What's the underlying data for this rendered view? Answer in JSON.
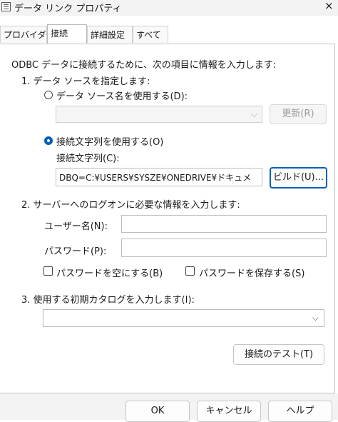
{
  "window": {
    "title": "データ リンク プロパティ",
    "close_glyph": "×"
  },
  "tabs": [
    {
      "label": "プロバイダー"
    },
    {
      "label": "接続"
    },
    {
      "label": "詳細設定"
    },
    {
      "label": "すべて"
    }
  ],
  "connection": {
    "intro": "ODBC データに接続するために、次の項目に情報を入力します:",
    "step1": "1. データ ソースを指定します:",
    "use_dsn_label": "データ ソース名を使用する(D):",
    "dsn_value": "",
    "refresh_button": "更新(R)",
    "use_connstr_label": "接続文字列を使用する(O)",
    "connstr_label": "接続文字列(C):",
    "connstr_value": "DBQ=C:¥USERS¥SYSZE¥ONEDRIVE¥ドキュメ",
    "build_button": "ビルド(U)...",
    "step2": "2. サーバーへのログオンに必要な情報を入力します:",
    "username_label": "ユーザー名(N):",
    "username_value": "",
    "password_label": "パスワード(P):",
    "password_value": "",
    "blank_password_label": "パスワードを空にする(B)",
    "save_password_label": "パスワードを保存する(S)",
    "step3": "3. 使用する初期カタログを入力します(I):",
    "catalog_value": "",
    "test_button": "接続のテスト(T)"
  },
  "footer": {
    "ok": "OK",
    "cancel": "キャンセル",
    "help": "ヘルプ"
  },
  "colors": {
    "accent": "#005fb8"
  }
}
